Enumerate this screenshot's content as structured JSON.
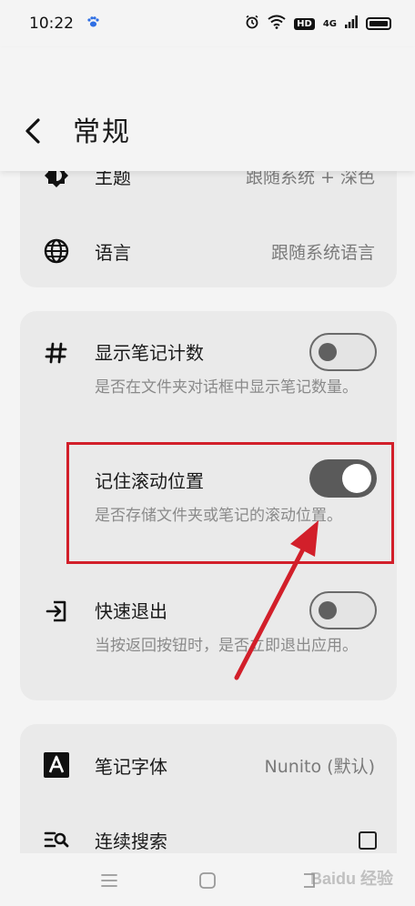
{
  "status_bar": {
    "time": "10:22",
    "hd": "HD",
    "network": "4G"
  },
  "header": {
    "title": "常规"
  },
  "card1": {
    "theme": {
      "label": "主题",
      "value": "跟随系统 + 深色"
    },
    "language": {
      "label": "语言",
      "value": "跟随系统语言"
    }
  },
  "card2": {
    "show_count": {
      "label": "显示笔记计数",
      "desc": "是否在文件夹对话框中显示笔记数量。",
      "enabled": false
    },
    "remember_scroll": {
      "label": "记住滚动位置",
      "desc": "是否存储文件夹或笔记的滚动位置。",
      "enabled": true
    },
    "quick_exit": {
      "label": "快速退出",
      "desc": "当按返回按钮时，是否立即退出应用。",
      "enabled": false
    }
  },
  "card3": {
    "font": {
      "label": "笔记字体",
      "value": "Nunito (默认)"
    },
    "continuous_search": {
      "label": "连续搜索",
      "checked": false
    }
  },
  "watermark": "Baidu 经验",
  "colors": {
    "background": "#f4f4f4",
    "card": "#eaeaea",
    "highlight": "#d21f2a",
    "toggle_on": "#5a5a5a"
  }
}
